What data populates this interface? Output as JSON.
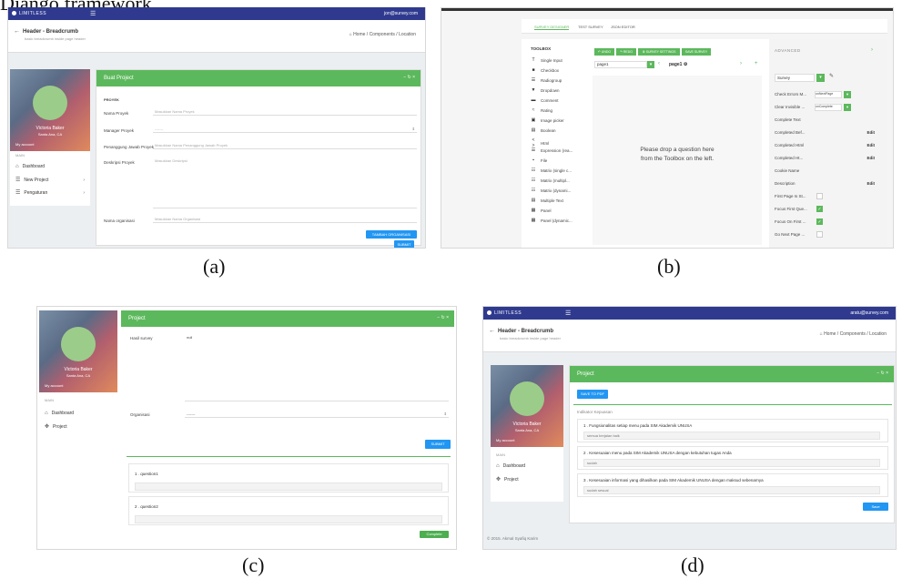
{
  "top_text": "Django framework.",
  "captions": {
    "a": "(a)",
    "b": "(b)",
    "c": "(c)",
    "d": "(d)"
  },
  "colors": {
    "navbar": "#2f3a8f",
    "green": "#5cb85c",
    "blue": "#2196f3",
    "avatar": "#9ccc8a"
  },
  "common": {
    "brand": "LIMITLESS",
    "menu_icon": "hamburger-icon",
    "page_title": "Header - Breadcrumb",
    "page_subtitle": "basic breadcrumb inside page header",
    "breadcrumb": "Home / Components / Location",
    "profile_name": "Victoria Baker",
    "profile_location": "Santa Ana, CA",
    "my_account": "My account",
    "main_section": "MAIN",
    "dashboard": "Dashboard",
    "card_controls": "− ↻ ×"
  },
  "a": {
    "user_email": "jon@survey.com",
    "side_items": [
      "Dashboard",
      "New Project",
      "Pengaturan"
    ],
    "card_title": "Buat Project",
    "section_label": "PROYEK",
    "fields": [
      {
        "label": "Nama Proyek",
        "placeholder": "Masukkan Nama Proyek"
      },
      {
        "label": "Manager Proyek",
        "placeholder": "-------"
      },
      {
        "label": "Penanggung Jawab Proyek",
        "placeholder": "Masukkan Nama Penanggung Jawab Proyek"
      },
      {
        "label": "Deskripsi Proyek",
        "placeholder": "Masukkan Deskripsi"
      },
      {
        "label": "Nama organisasi",
        "placeholder": "Masukkan Nama Organisasi"
      }
    ],
    "btn_add": "TAMBAH ORGANISASI",
    "btn_submit": "SUBMIT"
  },
  "b": {
    "tabs": [
      "SURVEY DESIGNER",
      "TEST SURVEY",
      "JSON EDITOR"
    ],
    "toolbox_title": "TOOLBOX",
    "tools": [
      "Single Input",
      "Checkbox",
      "Radiogroup",
      "Dropdown",
      "Comment",
      "Rating",
      "Image picker",
      "Boolean",
      "Html",
      "Expression (rea...",
      "File",
      "Matrix (single c...",
      "Matrix (multipl...",
      "Matrix (dynami...",
      "Multiple Text",
      "Panel",
      "Panel (dynamic..."
    ],
    "tool_icons": [
      "T",
      "■",
      "☰",
      "▼",
      "▬",
      "≈",
      "▣",
      "▤",
      "< >",
      "☰",
      "▪",
      "☷",
      "☷",
      "☷",
      "▤",
      "▦",
      "▦"
    ],
    "toolbar": [
      "UNDO",
      "REDO",
      "SURVEY SETTINGS",
      "SAVE SURVEY"
    ],
    "page_select": "page1",
    "page_name": "page1",
    "drop_text_1": "Please drop a question here",
    "drop_text_2": "from the Toolbox on the left.",
    "advanced": "ADVANCED",
    "object_select": "Survey",
    "props": [
      {
        "name": "Check Errors M...",
        "value": "onNextPage",
        "type": "select"
      },
      {
        "name": "Clear Invisible ...",
        "value": "onComplete",
        "type": "select"
      },
      {
        "name": "Complete Text",
        "value": "",
        "type": "text"
      },
      {
        "name": "Completed Bef...",
        "value": "Edit",
        "type": "edit"
      },
      {
        "name": "Completed Html",
        "value": "Edit",
        "type": "edit"
      },
      {
        "name": "Completed Ht...",
        "value": "Edit",
        "type": "edit"
      },
      {
        "name": "Cookie Name",
        "value": "",
        "type": "text"
      },
      {
        "name": "Description",
        "value": "Edit",
        "type": "edit"
      },
      {
        "name": "First Page Is St...",
        "value": "",
        "type": "check"
      },
      {
        "name": "Focus First Que...",
        "value": "",
        "type": "check-on"
      },
      {
        "name": "Focus On First ...",
        "value": "",
        "type": "check-on"
      },
      {
        "name": "Go Next Page ...",
        "value": "",
        "type": "check"
      }
    ]
  },
  "c": {
    "side_items": [
      "Dashboard",
      "Project"
    ],
    "card_title": "Project",
    "result_label": "Hasil survey",
    "result_value": "null",
    "org_label": "Organisasi",
    "org_value": "-------",
    "btn_submit": "SUBMIT",
    "questions": [
      "1 . question1",
      "2 . question2"
    ],
    "btn_complete": "Complete"
  },
  "d": {
    "user_email": "aratu@survey.com",
    "side_items": [
      "Dashboard",
      "Project"
    ],
    "card_title": "Project",
    "btn_save_pdf": "SAVE TO PDF",
    "section_title": "Indikator Kepuasan",
    "questions": [
      {
        "q": "1 . Fungsionalitas setiap menu pada SIM Akademik UNUSA",
        "a": "semua berjalan baik"
      },
      {
        "q": "2 . Kesesuaian menu pada SIM Akademik UNUSA dengan kebutuhan tugas Anda",
        "a": "sudah"
      },
      {
        "q": "3 . Kesesuaian informasi yang dihasilkan pada SIM Akademik UNUSA dengan maksud sebenarnya",
        "a": "sudah sesuai"
      }
    ],
    "btn_save": "Save",
    "footer": "© 2015. Akmal Syafiq Karim"
  }
}
